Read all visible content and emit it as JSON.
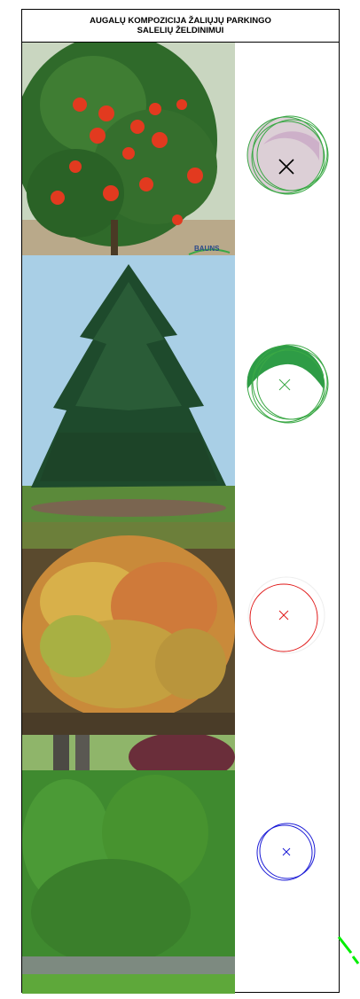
{
  "sheet": {
    "title_line1": "AUGALŲ KOMPOZICIJA ŽALIŲJŲ PARKINGO",
    "title_line2": "SALELIŲ ŽELDINIMUI"
  },
  "plants": [
    {
      "photo": "rowan-tree-with-red-berries",
      "symbol_color": "#3aa845",
      "symbol_fill": "#dccfd6",
      "cross_color": "#000000"
    },
    {
      "photo": "pine-tree",
      "symbol_color": "#3aa845",
      "symbol_fill": "#2e9c46",
      "cross_color": "#3aa845"
    },
    {
      "photo": "spirea-shrub-orange-yellow",
      "symbol_color": "#e01919",
      "cross_color": "#e01919"
    },
    {
      "photo": "green-hedge-shrubs",
      "symbol_color": "#1a1ad6",
      "cross_color": "#1a1ad6"
    }
  ],
  "watermark": {
    "text": "BAUNS"
  },
  "colors": {
    "accent_green": "#00ee00",
    "border": "#000000"
  }
}
